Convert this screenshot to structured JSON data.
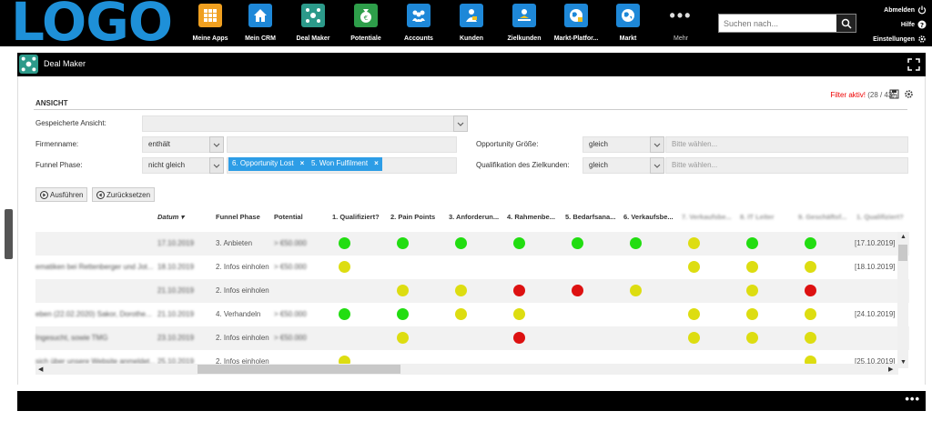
{
  "brand": {
    "logo_text": "LOGO",
    "color": "#1e90d8"
  },
  "nav": [
    {
      "label": "Meine Apps",
      "icon": "apps-grid-icon",
      "color": "#f0a020"
    },
    {
      "label": "Mein CRM",
      "icon": "home-icon",
      "color": "#1e88d8"
    },
    {
      "label": "Deal Maker",
      "icon": "deal-maker-icon",
      "color": "#2c9a8a"
    },
    {
      "label": "Potentiale",
      "icon": "money-bag-icon",
      "color": "#2e9e4a"
    },
    {
      "label": "Accounts",
      "icon": "accounts-people-icon",
      "color": "#1e88d8"
    },
    {
      "label": "Kunden",
      "icon": "customer-icon",
      "color": "#1e88d8"
    },
    {
      "label": "Zielkunden",
      "icon": "target-customer-icon",
      "color": "#1e88d8"
    },
    {
      "label": "Markt-Platfor...",
      "icon": "market-platform-icon",
      "color": "#1e88d8"
    },
    {
      "label": "Markt",
      "icon": "globe-icon",
      "color": "#1e88d8"
    },
    {
      "label": "Mehr",
      "icon": "more-dots-icon",
      "color": "#000000"
    }
  ],
  "search": {
    "placeholder": "Suchen nach..."
  },
  "user_links": {
    "logout": "Abmelden",
    "help": "Hilfe",
    "settings": "Einstellungen"
  },
  "panel": {
    "title": "Deal Maker"
  },
  "view": {
    "section_title": "ANSICHT",
    "filter_status": "Filter aktiv!",
    "filter_count": "(28 / 43)",
    "saved_view_label": "Gespeicherte Ansicht:",
    "saved_view_value": "",
    "company_label": "Firmenname:",
    "company_op": "enthält",
    "company_value": "",
    "funnel_label": "Funnel Phase:",
    "funnel_op": "nicht gleich",
    "funnel_tags": [
      "6. Opportunity Lost",
      "5. Won Fulfilment"
    ],
    "opp_size_label": "Opportunity Größe:",
    "opp_size_op": "gleich",
    "opp_size_placeholder": "Bitte wählen...",
    "qual_label": "Qualifikation des Zielkunden:",
    "qual_op": "gleich",
    "qual_placeholder": "Bitte wählen...",
    "run_button": "Ausführen",
    "reset_button": "Zurücksetzen"
  },
  "table": {
    "headers": {
      "datum": "Datum",
      "funnel": "Funnel Phase",
      "potential": "Potential",
      "c1": "1. Qualifiziert?",
      "c2": "2. Pain Points",
      "c3": "3. Anforderun...",
      "c4": "4. Rahmenbe...",
      "c5": "5. Bedarfsana...",
      "c6": "6. Verkaufsbe...",
      "c7": "7. Verkaufsbe...",
      "c8": "8. IT Leiter",
      "c9": "9. Geschäftsf...",
      "c10": "1. Qualifiziert?"
    },
    "rows": [
      {
        "name": "",
        "date": "17.10.2019",
        "phase": "3. Anbieten",
        "potential": "> €50.000",
        "dots": [
          "g",
          "g",
          "g",
          "g",
          "g",
          "g",
          "y",
          "g",
          "g"
        ],
        "last": "[17.10.2019]"
      },
      {
        "name": "ematiken bei Rettenberger und Jot...",
        "date": "18.10.2019",
        "phase": "2. Infos einholen",
        "potential": "> €50.000",
        "dots": [
          "y",
          "",
          "",
          "",
          "",
          "",
          "y",
          "y",
          "y"
        ],
        "last": "[18.10.2019]"
      },
      {
        "name": "",
        "date": "21.10.2019",
        "phase": "2. Infos einholen",
        "potential": "",
        "dots": [
          "",
          "y",
          "y",
          "r",
          "r",
          "y",
          "",
          "y",
          "r"
        ],
        "last": ""
      },
      {
        "name": "eben (22.02.2020) Sakor, Dorothe...",
        "date": "21.10.2019",
        "phase": "4. Verhandeln",
        "potential": "> €50.000",
        "dots": [
          "g",
          "g",
          "y",
          "y",
          "",
          "",
          "y",
          "y",
          "y"
        ],
        "last": "[24.10.2019]"
      },
      {
        "name": "Ingesucht, sowie TMG",
        "date": "23.10.2019",
        "phase": "2. Infos einholen",
        "potential": "> €50.000",
        "dots": [
          "",
          "y",
          "",
          "r",
          "",
          "",
          "y",
          "y",
          "y"
        ],
        "last": ""
      },
      {
        "name": "sich über unsere Website anmeldet...",
        "date": "25.10.2019",
        "phase": "2. Infos einholen",
        "potential": "",
        "dots": [
          "y",
          "",
          "",
          "",
          "",
          "",
          "",
          "",
          "y"
        ],
        "last": "[25.10.2019]"
      }
    ]
  }
}
